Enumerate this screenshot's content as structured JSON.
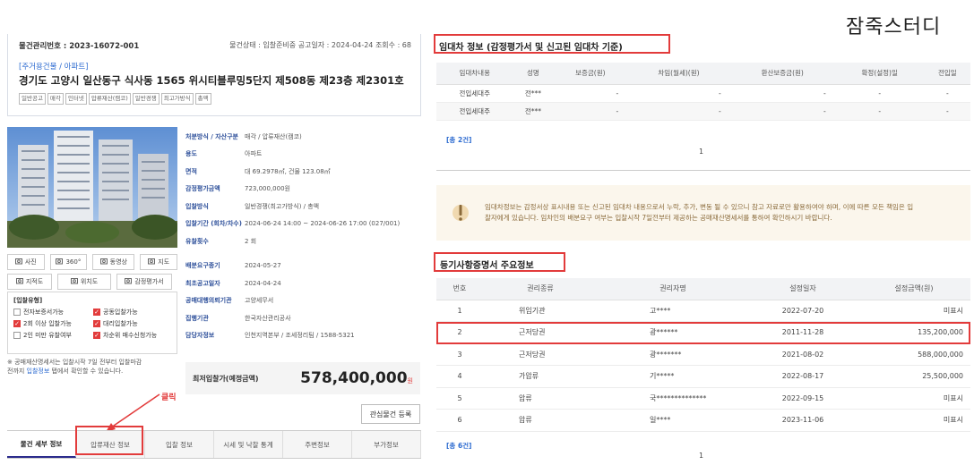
{
  "watermark": "잠죽스터디",
  "left": {
    "mgmt_no": "물건관리번호 : 2023-16072-001",
    "status_line": "물건상태 : 입찰준비중  공고일자 : 2024-04-24  조회수 : 68",
    "category": "[주거용건물 / 아파트]",
    "address": "경기도 고양시 일산동구 식사동 1565 위시티블루밍5단지 제508동 제23층 제2301호",
    "tags": [
      "일반공고",
      "매각",
      "인터넷",
      "압류재산(캠코)",
      "일반경쟁",
      "최고가방식",
      "총액"
    ],
    "media_buttons": [
      {
        "icon": "camera-icon",
        "label": "사진"
      },
      {
        "icon": "360-icon",
        "label": "360°"
      },
      {
        "icon": "video-icon",
        "label": "동영상"
      },
      {
        "icon": "map-icon",
        "label": "지도"
      }
    ],
    "media_buttons2": [
      {
        "icon": "cadastral-icon",
        "label": "지적도"
      },
      {
        "icon": "location-icon",
        "label": "위치도"
      },
      {
        "icon": "appraisal-icon",
        "label": "감정평가서"
      }
    ],
    "options_title": "[입찰유형]",
    "options": [
      {
        "label": "전자보증서가능",
        "checked": false
      },
      {
        "label": "공동입찰가능",
        "checked": true
      },
      {
        "label": "2회 이상 입찰가능",
        "checked": true
      },
      {
        "label": "대리입찰가능",
        "checked": true
      },
      {
        "label": "2인 미만 유찰여부",
        "checked": false
      },
      {
        "label": "차순위 매수신청가능",
        "checked": true
      }
    ],
    "notice_a": "※ 공매재산명세서는 입찰시작 7일 전부터 입찰마감",
    "notice_b": "전까지 ",
    "notice_link": "입찰정보",
    "notice_c": " 탭에서 확인할 수 있습니다.",
    "info_rows": [
      {
        "k": "처분방식 / 자산구분",
        "v": "매각 / 압류재산(캠코)"
      },
      {
        "k": "용도",
        "v": "아파트"
      },
      {
        "k": "면적",
        "v": "대 69.2978㎡, 건물 123.08㎡"
      },
      {
        "k": "감정평가금액",
        "v": "723,000,000원"
      },
      {
        "k": "입찰방식",
        "v": "일반경쟁(최고가방식) / 총액"
      },
      {
        "k": "입찰기간 (회차/차수)",
        "v": "2024-06-24 14:00 ~ 2024-06-26 17:00 (027/001)"
      },
      {
        "k": "유찰횟수",
        "v": "2 회"
      },
      {
        "k": "배분요구종기",
        "v": "2024-05-27"
      },
      {
        "k": "최초공고일자",
        "v": "2024-04-24"
      },
      {
        "k": "공매대행의뢰기관",
        "v": "고양세무서"
      },
      {
        "k": "집행기관",
        "v": "한국자산관리공사"
      },
      {
        "k": "담당자정보",
        "v": "인천지역본부 / 조세정리팀 / 1588-5321"
      }
    ],
    "price_label": "최저입찰가(예정금액)",
    "price_value": "578,400,000",
    "price_unit": "원",
    "watch_button": "관심물건 등록",
    "click_label": "클릭",
    "tabs": [
      "물건 세부 정보",
      "압류재산 정보",
      "입찰 정보",
      "시세 및 낙찰 통계",
      "주변정보",
      "부가정보"
    ]
  },
  "right": {
    "lease_title": "임대차 정보 (감정평가서 및 신고된 임대차 기준)",
    "lease_headers": [
      "임대차내용",
      "성명",
      "보증금(원)",
      "차임(월세)(원)",
      "환산보증금(원)",
      "확정(설정)일",
      "전입일"
    ],
    "lease_rows": [
      [
        "전입세대주",
        "전***",
        "-",
        "-",
        "-",
        "-",
        "-"
      ],
      [
        "전입세대주",
        "전***",
        "-",
        "-",
        "-",
        "-",
        "-"
      ]
    ],
    "lease_total": "[총 2건]",
    "lease_page": "1",
    "warning": "임대차정보는 감정서상 표시내용 또는 신고된 임대차 내용으로서 누락, 추가, 변동 될 수 있으니 참고 자료로만 활용하여야 하며, 이에 따른 모든 책임은 입찰자에게 있습니다. 임차인의 배분요구 여부는 입찰시작 7일전부터 제공하는 공매재산명세서를 통하여 확인하시기 바랍니다.",
    "reg_title": "등기사항증명서 주요정보",
    "reg_headers": [
      "번호",
      "권리종류",
      "권리자명",
      "설정일자",
      "설정금액(원)"
    ],
    "reg_rows": [
      [
        "1",
        "위임기관",
        "고****",
        "2022-07-20",
        "미표시"
      ],
      [
        "2",
        "근저당권",
        "광******",
        "2011-11-28",
        "135,200,000"
      ],
      [
        "3",
        "근저당권",
        "광*******",
        "2021-08-02",
        "588,000,000"
      ],
      [
        "4",
        "가압류",
        "기*****",
        "2022-08-17",
        "25,500,000"
      ],
      [
        "5",
        "압류",
        "국**************",
        "2022-09-15",
        "미표시"
      ],
      [
        "6",
        "압류",
        "일****",
        "2023-11-06",
        "미표시"
      ]
    ],
    "reg_total": "[총 6건]",
    "reg_page": "1"
  }
}
